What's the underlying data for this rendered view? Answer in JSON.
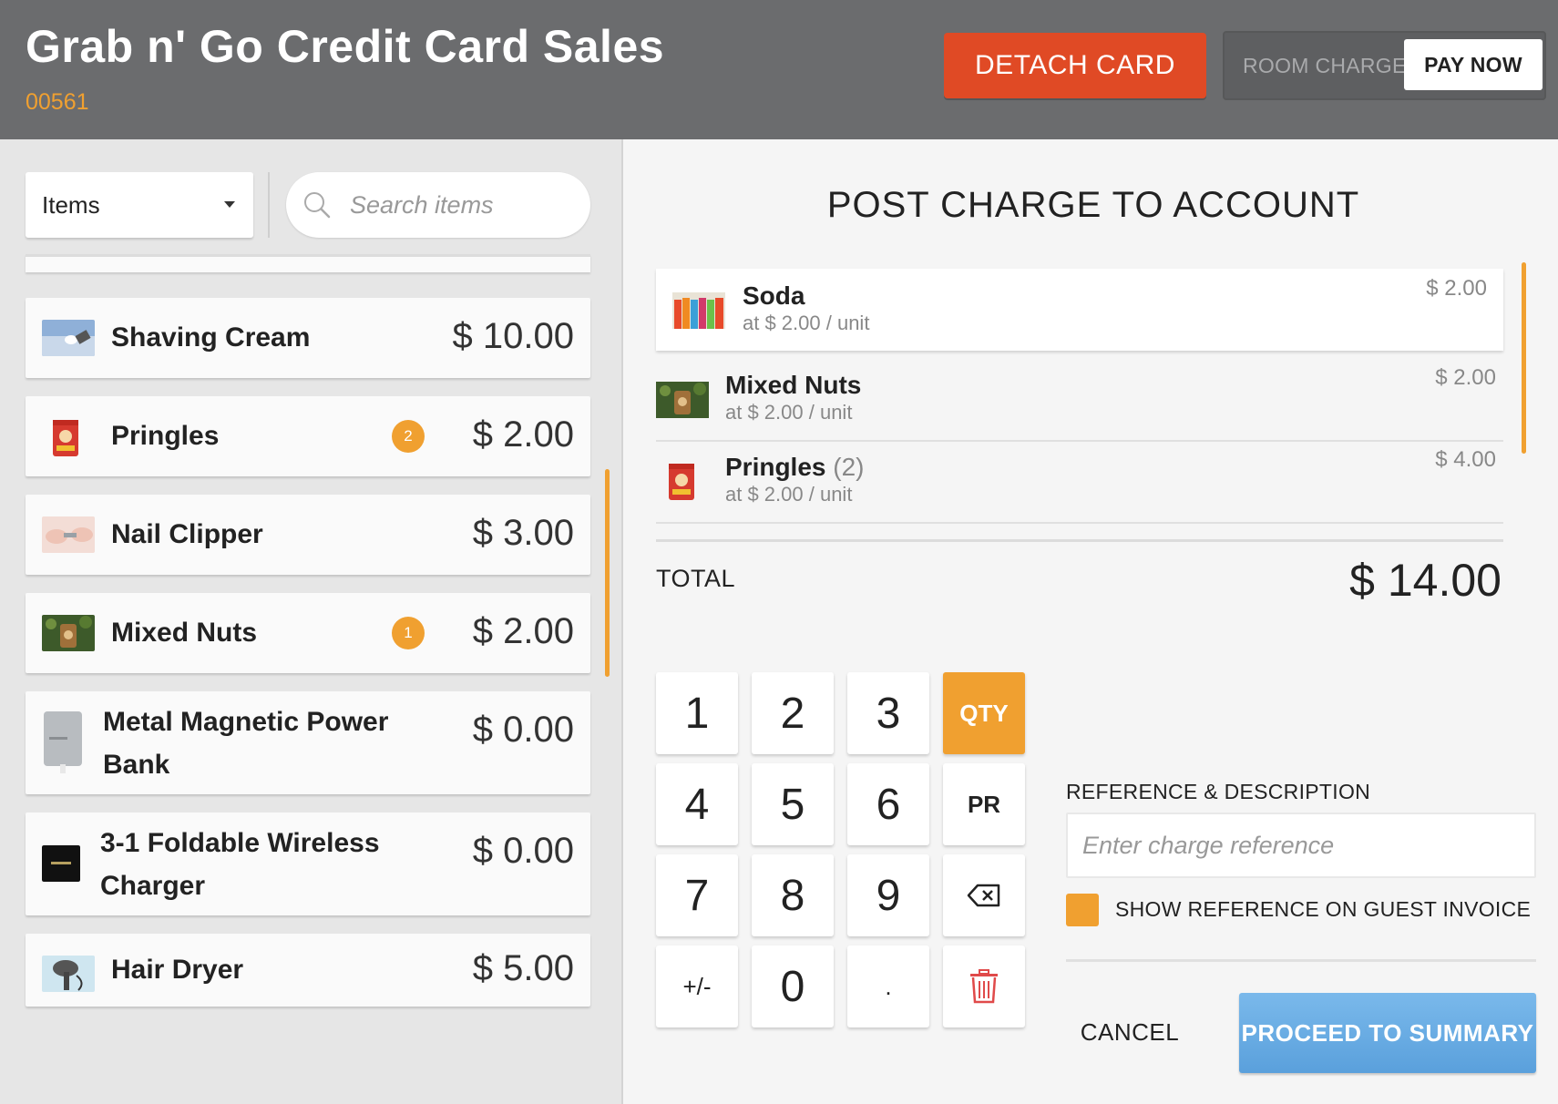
{
  "header": {
    "title": "Grab n' Go Credit Card Sales",
    "subtitle": "00561",
    "detach_label": "DETACH CARD",
    "room_charge_label": "ROOM CHARGE",
    "pay_now_label": "PAY NOW"
  },
  "filter": {
    "category_selected": "Items",
    "search_placeholder": "Search items"
  },
  "items": [
    {
      "name": "Shaving Cream",
      "price": "$ 10.00",
      "badge": "",
      "icon": "shaving-cream-image"
    },
    {
      "name": "Pringles",
      "price": "$ 2.00",
      "badge": "2",
      "icon": "pringles-image"
    },
    {
      "name": "Nail Clipper",
      "price": "$ 3.00",
      "badge": "",
      "icon": "nail-clipper-image"
    },
    {
      "name": "Mixed Nuts",
      "price": "$ 2.00",
      "badge": "1",
      "icon": "mixed-nuts-image"
    },
    {
      "name": "Metal Magnetic Power Bank",
      "price": "$ 0.00",
      "badge": "",
      "icon": "power-bank-image"
    },
    {
      "name": "3-1 Foldable Wireless Charger",
      "price": "$ 0.00",
      "badge": "",
      "icon": "wireless-charger-image"
    },
    {
      "name": "Hair Dryer",
      "price": "$ 5.00",
      "badge": "",
      "icon": "hair-dryer-image"
    }
  ],
  "charge": {
    "title": "POST CHARGE TO ACCOUNT",
    "lines": [
      {
        "name": "Soda",
        "qty": "",
        "unit_price": "at $ 2.00 / unit",
        "line_total": "$ 2.00"
      },
      {
        "name": "Mixed Nuts",
        "qty": "",
        "unit_price": "at $ 2.00 / unit",
        "line_total": "$ 2.00"
      },
      {
        "name": "Pringles",
        "qty": "(2)",
        "unit_price": "at $ 2.00 / unit",
        "line_total": "$ 4.00"
      }
    ],
    "total_label": "TOTAL",
    "total_value": "$ 14.00"
  },
  "keypad": {
    "k1": "1",
    "k2": "2",
    "k3": "3",
    "qty": "QTY",
    "k4": "4",
    "k5": "5",
    "k6": "6",
    "pr": "PR",
    "k7": "7",
    "k8": "8",
    "k9": "9",
    "sign": "+/-",
    "k0": "0",
    "dot": "."
  },
  "reference": {
    "label": "REFERENCE & DESCRIPTION",
    "placeholder": "Enter charge reference",
    "value": "",
    "show_on_invoice_label": "SHOW REFERENCE ON GUEST INVOICE",
    "show_on_invoice_checked": true
  },
  "actions": {
    "cancel_label": "CANCEL",
    "proceed_label": "PROCEED TO SUMMARY"
  },
  "colors": {
    "header_bg": "#6b6c6e",
    "accent": "#f0a030",
    "detach": "#e04a25",
    "proceed": "#6aaee4"
  }
}
